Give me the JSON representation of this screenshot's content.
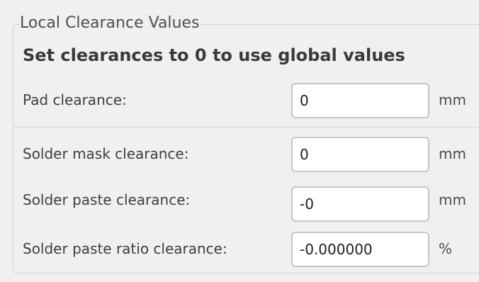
{
  "group": {
    "title": "Local Clearance Values",
    "note": "Set clearances to 0 to use global values"
  },
  "rows": [
    {
      "label": "Pad clearance:",
      "value": "0",
      "unit": "mm"
    },
    {
      "label": "Solder mask clearance:",
      "value": "0",
      "unit": "mm"
    },
    {
      "label": "Solder paste clearance:",
      "value": "-0",
      "unit": "mm"
    },
    {
      "label": "Solder paste ratio clearance:",
      "value": "-0.000000",
      "unit": "%"
    }
  ]
}
